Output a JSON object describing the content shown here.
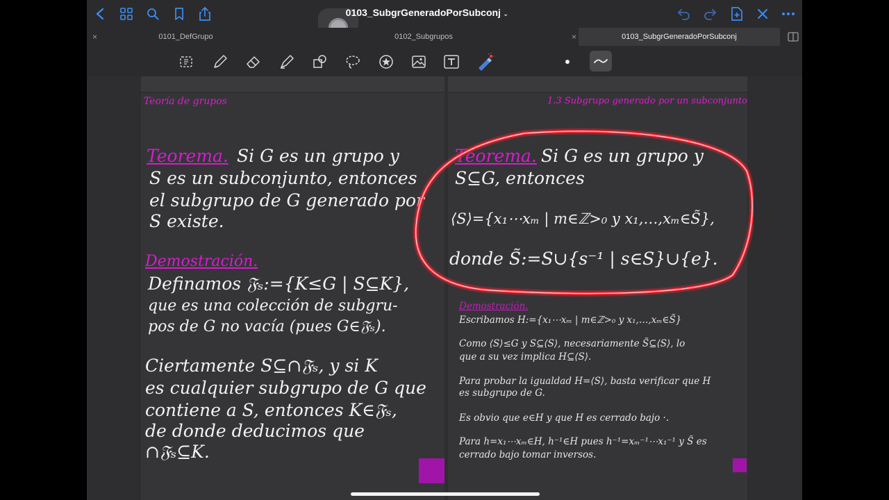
{
  "topbar": {
    "title": "0103_SubgrGeneradoPorSubconj",
    "title_chevron": "⌄",
    "icons": [
      "back-icon",
      "grid-icon",
      "search-icon",
      "bookmark-icon",
      "share-icon",
      "undo-icon",
      "redo-icon",
      "add-page-icon",
      "close-icon",
      "more-icon"
    ]
  },
  "tabs": [
    {
      "label": "0101_DefGrupo",
      "active": false
    },
    {
      "label": "0102_Subgrupos",
      "active": false
    },
    {
      "label": "0103_SubgrGeneradoPorSubconj",
      "active": true
    }
  ],
  "tab_close_glyph": "×",
  "toolbar": {
    "tools": [
      "lasso-text-icon",
      "pen-icon",
      "eraser-icon",
      "highlighter-icon",
      "shapes-icon",
      "lasso-icon",
      "sticker-icon",
      "image-icon",
      "text-icon",
      "laser-pointer-icon",
      "pen-size-icon",
      "stroke-style-icon"
    ]
  },
  "colors": {
    "ink_pink": "#e01ad0",
    "ink_white": "#f2f2f2",
    "laser_red": "#ff1f2e",
    "square_purple": "#a015a8"
  },
  "left_page": {
    "header": "Teoría de grupos",
    "theorem_title": "Teorema.",
    "theorem_lines": [
      "Si G es un grupo y",
      "S es un subconjunto, entonces",
      "el subgrupo de G generado por",
      "S existe."
    ],
    "proof_title": "Demostración.",
    "proof_lines": [
      "Definamos   𝔉ₛ:={K≤G | S⊆K},",
      "que  es una colección de subgru-",
      "pos de G no vacía (pues G∈𝔉ₛ).",
      "Ciertamente  S⊆∩𝔉ₛ, y si K",
      "es cualquier subgrupo de G que",
      "contiene a S, entonces K∈𝔉ₛ,",
      "de donde deducimos que",
      "∩𝔉ₛ⊆K."
    ]
  },
  "right_page": {
    "header": "1.3 Subgrupo generado por un subconjunto",
    "theorem_title": "Teorema.",
    "theorem_lines": [
      "Si G es un grupo y",
      "S⊆G, entonces",
      "⟨S⟩={x₁⋯xₘ | m∈ℤ>₀ y x₁,…,xₘ∈S̃},",
      "donde S̃:=S∪{s⁻¹ | s∈S}∪{e}."
    ],
    "proof_title": "Demostración.",
    "proof_lines": [
      "Escribamos H:={x₁⋯xₘ | m∈ℤ>₀ y x₁,…,xₘ∈S̃}",
      "Como ⟨S⟩≤G y S⊆⟨S⟩, necesariamente S̃⊆⟨S⟩, lo",
      "que a su vez implica H⊆⟨S⟩.",
      "Para probar la igualdad H=⟨S⟩, basta verificar que H",
      "es subgrupo de G.",
      "Es obvio que e∈H y que H es cerrado bajo ·.",
      "Para h=x₁⋯xₘ∈H, h⁻¹∈H pues h⁻¹=xₘ⁻¹⋯x₁⁻¹ y S̃ es",
      "cerrado bajo tomar inversos."
    ]
  }
}
